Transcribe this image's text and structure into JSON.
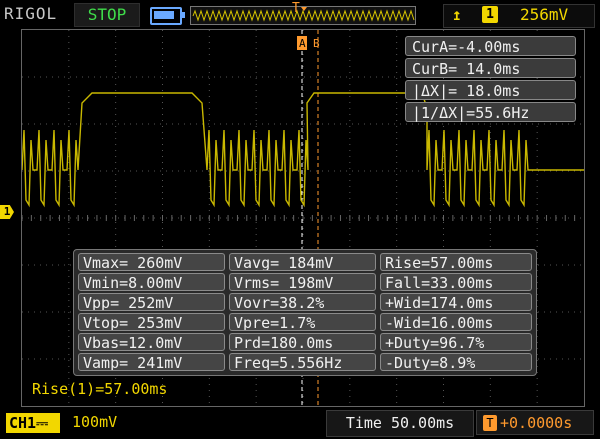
{
  "header": {
    "brand": "RIGOL",
    "run_state": "STOP",
    "trigger_edge_icon": "rising-edge-icon",
    "trigger_channel": "1",
    "trigger_level": "256mV",
    "trigger_marker": "T"
  },
  "colors": {
    "ch1": "#f2d700",
    "trigger": "#ff9a2e",
    "run_stop": "#3fdc4a",
    "cursor_a": "#ffffff",
    "cursor_b": "#ff9a2e"
  },
  "cursor": {
    "a_marker": "A",
    "b_marker": "B",
    "readouts": [
      "CurA=-4.00ms",
      "CurB= 14.0ms",
      "|ΔX|= 18.0ms",
      "|1/ΔX|=55.6Hz"
    ]
  },
  "measurements": {
    "col1": [
      "Vmax= 260mV",
      "Vmin=8.00mV",
      "Vpp= 252mV",
      "Vtop= 253mV",
      "Vbas=12.0mV",
      "Vamp= 241mV"
    ],
    "col2": [
      "Vavg= 184mV",
      "Vrms= 198mV",
      "Vovr=38.2%",
      "Vpre=1.7%",
      "Prd=180.0ms",
      "Freq=5.556Hz"
    ],
    "col3": [
      "Rise=57.00ms",
      "Fall=33.00ms",
      "+Wid=174.0ms",
      "-Wid=16.00ms",
      "+Duty=96.7%",
      "-Duty=8.9%"
    ]
  },
  "measure_line": "Rise(1)=57.00ms",
  "channel_marker": "1",
  "footer": {
    "channel_label": "CH1",
    "coupling_icon": "dc-coupling-icon",
    "volts_per_div": "100mV",
    "timebase": "Time 50.00ms",
    "trigger_offset_badge": "T",
    "trigger_offset": "+0.0000s"
  }
}
